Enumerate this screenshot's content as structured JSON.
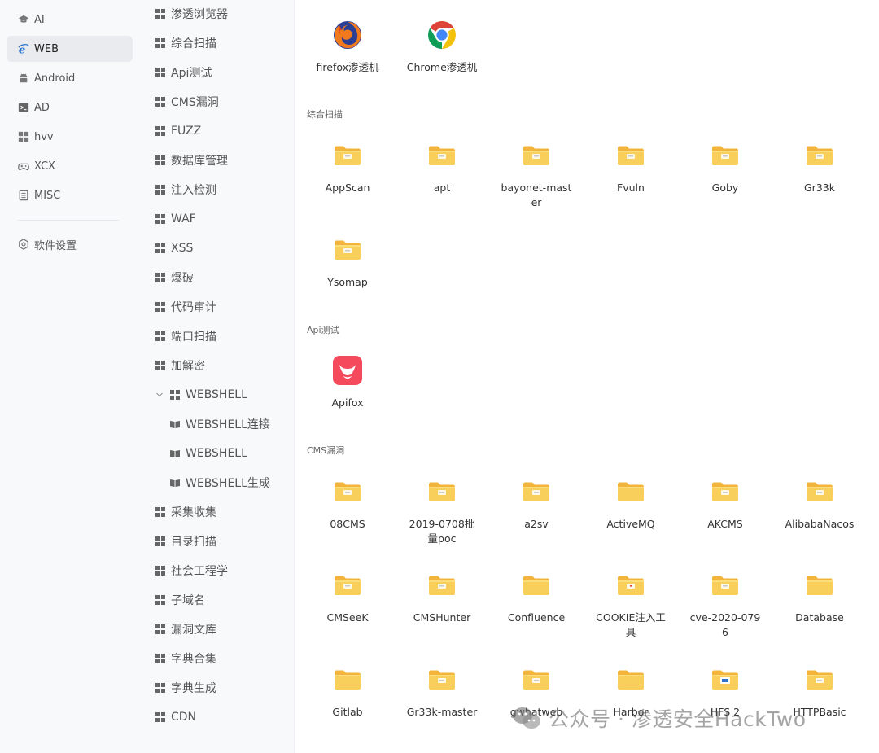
{
  "primary_nav": [
    {
      "label": "AI",
      "icon": "graduation-cap-icon"
    },
    {
      "label": "WEB",
      "icon": "ie-icon",
      "active": true
    },
    {
      "label": "Android",
      "icon": "android-icon"
    },
    {
      "label": "AD",
      "icon": "terminal-icon"
    },
    {
      "label": "hvv",
      "icon": "grid-icon"
    },
    {
      "label": "XCX",
      "icon": "gamepad-icon"
    },
    {
      "label": "MISC",
      "icon": "notebook-icon"
    }
  ],
  "settings_label": "软件设置",
  "categories": [
    {
      "label": "渗透浏览器"
    },
    {
      "label": "综合扫描"
    },
    {
      "label": "Api测试"
    },
    {
      "label": "CMS漏洞"
    },
    {
      "label": "FUZZ"
    },
    {
      "label": "数据库管理"
    },
    {
      "label": "注入检测"
    },
    {
      "label": "WAF"
    },
    {
      "label": "XSS"
    },
    {
      "label": "爆破"
    },
    {
      "label": "代码审计"
    },
    {
      "label": "端口扫描"
    },
    {
      "label": "加解密"
    },
    {
      "label": "WEBSHELL",
      "expanded": true
    },
    {
      "label": "WEBSHELL连接",
      "sub": true
    },
    {
      "label": "WEBSHELL",
      "sub": true
    },
    {
      "label": "WEBSHELL生成",
      "sub": true
    },
    {
      "label": "采集收集"
    },
    {
      "label": "目录扫描"
    },
    {
      "label": "社会工程学"
    },
    {
      "label": "子域名"
    },
    {
      "label": "漏洞文库"
    },
    {
      "label": "字典合集"
    },
    {
      "label": "字典生成"
    },
    {
      "label": "CDN"
    }
  ],
  "sections": [
    {
      "title": "",
      "tiles": [
        {
          "label": "firefox渗透机",
          "icon": "firefox-icon"
        },
        {
          "label": "Chrome渗透机",
          "icon": "chrome-icon"
        }
      ]
    },
    {
      "title": "综合扫描",
      "tiles": [
        {
          "label": "AppScan",
          "icon": "folder-icon"
        },
        {
          "label": "apt",
          "icon": "folder-icon"
        },
        {
          "label": "bayonet-master",
          "icon": "folder-icon"
        },
        {
          "label": "Fvuln",
          "icon": "folder-icon"
        },
        {
          "label": "Goby",
          "icon": "folder-icon"
        },
        {
          "label": "Gr33k",
          "icon": "folder-icon"
        },
        {
          "label": "Ysomap",
          "icon": "folder-icon"
        }
      ]
    },
    {
      "title": "Api测试",
      "tiles": [
        {
          "label": "Apifox",
          "icon": "apifox-icon"
        }
      ]
    },
    {
      "title": "CMS漏洞",
      "tiles": [
        {
          "label": "08CMS",
          "icon": "folder-icon"
        },
        {
          "label": "2019-0708批量poc",
          "icon": "folder-icon"
        },
        {
          "label": "a2sv",
          "icon": "folder-icon"
        },
        {
          "label": "ActiveMQ",
          "icon": "folder-plain-icon"
        },
        {
          "label": "AKCMS",
          "icon": "folder-icon"
        },
        {
          "label": "AlibabaNacos",
          "icon": "folder-icon"
        },
        {
          "label": "CMSeeK",
          "icon": "folder-icon"
        },
        {
          "label": "CMSHunter",
          "icon": "folder-icon"
        },
        {
          "label": "Confluence",
          "icon": "folder-plain-icon"
        },
        {
          "label": "COOKIE注入工具",
          "icon": "folder-red-icon"
        },
        {
          "label": "cve-2020-0796",
          "icon": "folder-icon"
        },
        {
          "label": "Database",
          "icon": "folder-plain-icon"
        },
        {
          "label": "Gitlab",
          "icon": "folder-plain-icon"
        },
        {
          "label": "Gr33k-master",
          "icon": "folder-icon"
        },
        {
          "label": "gwhatweb",
          "icon": "folder-icon"
        },
        {
          "label": "Harbor",
          "icon": "folder-plain-icon"
        },
        {
          "label": "HFS 2",
          "icon": "folder-blue-icon"
        },
        {
          "label": "HTTPBasic",
          "icon": "folder-icon"
        }
      ]
    }
  ],
  "watermark": "公众号 · 渗透安全HackTwo"
}
